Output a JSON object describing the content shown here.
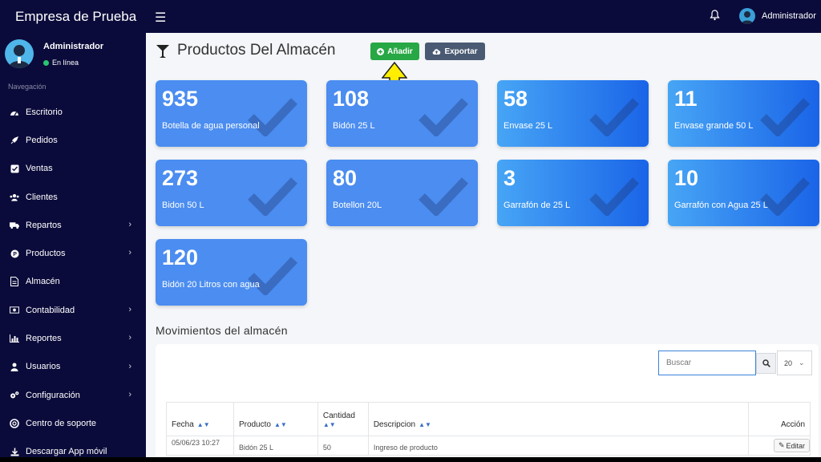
{
  "header": {
    "brand": "Empresa de Prueba",
    "user": "Administrador"
  },
  "sidebar": {
    "user_name": "Administrador",
    "status": "En línea",
    "section": "Navegación",
    "items": [
      {
        "label": "Escritorio",
        "icon": "dashboard-icon",
        "has_children": false
      },
      {
        "label": "Pedidos",
        "icon": "rocket-icon",
        "has_children": false
      },
      {
        "label": "Ventas",
        "icon": "checkbox-icon",
        "has_children": false
      },
      {
        "label": "Clientes",
        "icon": "users-icon",
        "has_children": false
      },
      {
        "label": "Repartos",
        "icon": "truck-icon",
        "has_children": true
      },
      {
        "label": "Productos",
        "icon": "product-icon",
        "has_children": true
      },
      {
        "label": "Almacén",
        "icon": "document-icon",
        "has_children": false
      },
      {
        "label": "Contabilidad",
        "icon": "money-icon",
        "has_children": true
      },
      {
        "label": "Reportes",
        "icon": "bar-chart-icon",
        "has_children": true
      },
      {
        "label": "Usuarios",
        "icon": "user-icon",
        "has_children": true
      },
      {
        "label": "Configuración",
        "icon": "gears-icon",
        "has_children": true
      },
      {
        "label": "Centro de soporte",
        "icon": "lifebuoy-icon",
        "has_children": false
      },
      {
        "label": "Descargar App móvil",
        "icon": "download-icon",
        "has_children": false
      }
    ]
  },
  "main": {
    "title": "Productos Del Almacén",
    "add_label": "Añadir",
    "export_label": "Exportar",
    "cards": [
      {
        "value": "935",
        "label": "Botella de agua personal",
        "style": "blue"
      },
      {
        "value": "108",
        "label": "Bidón 25 L",
        "style": "blue"
      },
      {
        "value": "58",
        "label": "Envase 25 L",
        "style": "gradient"
      },
      {
        "value": "11",
        "label": "Envase grande 50 L",
        "style": "gradient"
      },
      {
        "value": "273",
        "label": "Bidon 50 L",
        "style": "blue"
      },
      {
        "value": "80",
        "label": "Botellon 20L",
        "style": "blue"
      },
      {
        "value": "3",
        "label": "Garrafón de 25 L",
        "style": "gradient"
      },
      {
        "value": "10",
        "label": "Garrafón con Agua 25 L",
        "style": "gradient"
      },
      {
        "value": "120",
        "label": "Bidón 20 Litros con agua",
        "style": "blue"
      }
    ],
    "movements_title": "Movimientos del almacén",
    "search_placeholder": "Buscar",
    "page_size": "20",
    "table": {
      "columns": [
        "Fecha",
        "Producto",
        "Cantidad",
        "Descripcion",
        "Acción"
      ],
      "rows": [
        {
          "fecha": "05/06/23 10:27",
          "producto": "Bidón 25 L",
          "cantidad": "50",
          "descripcion": "Ingreso de producto",
          "accion": "Editar"
        }
      ]
    }
  },
  "colors": {
    "navy": "#0b0b3b",
    "card_blue": "#4b8df0",
    "add_green": "#28a745",
    "export_gray": "#4a5a73",
    "arrow_yellow": "#ffee00"
  }
}
